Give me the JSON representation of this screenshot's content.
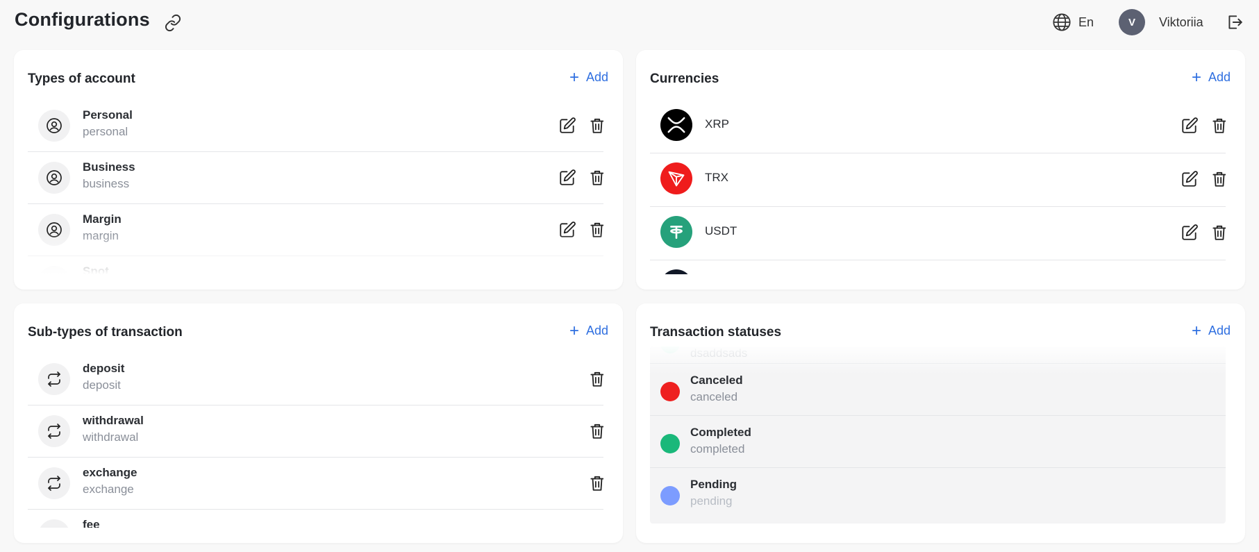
{
  "header": {
    "title": "Configurations",
    "language": "En",
    "user_initial": "V",
    "user_name": "Viktoriia"
  },
  "colors": {
    "accent": "#2f6fe0",
    "avatar_bg": "#5c6172",
    "xrp": "#000000",
    "trx": "#ef1c1c",
    "usdt": "#26a17b",
    "status_canceled": "#ee2020",
    "status_completed": "#1ab87a",
    "status_pending": "#7c9cff"
  },
  "account_types": {
    "title": "Types of account",
    "add_label": "Add",
    "items": [
      {
        "name": "Personal",
        "code": "personal"
      },
      {
        "name": "Business",
        "code": "business"
      },
      {
        "name": "Margin",
        "code": "margin"
      },
      {
        "name": "Spot",
        "code": ""
      }
    ]
  },
  "currencies": {
    "title": "Currencies",
    "add_label": "Add",
    "items": [
      {
        "name": "XRP",
        "icon": "xrp-logo-icon"
      },
      {
        "name": "TRX",
        "icon": "trx-logo-icon"
      },
      {
        "name": "USDT",
        "icon": "usdt-logo-icon"
      },
      {
        "name": "",
        "icon": "coin-logo-icon"
      }
    ]
  },
  "transaction_subtypes": {
    "title": "Sub-types of transaction",
    "add_label": "Add",
    "items": [
      {
        "name": "deposit",
        "code": "deposit"
      },
      {
        "name": "withdrawal",
        "code": "withdrawal"
      },
      {
        "name": "exchange",
        "code": "exchange"
      },
      {
        "name": "fee",
        "code": ""
      }
    ]
  },
  "transaction_statuses": {
    "title": "Transaction statuses",
    "add_label": "Add",
    "items": [
      {
        "name": "",
        "code": "dsaddsads"
      },
      {
        "name": "Canceled",
        "code": "canceled"
      },
      {
        "name": "Completed",
        "code": "completed"
      },
      {
        "name": "Pending",
        "code": "pending"
      }
    ]
  }
}
